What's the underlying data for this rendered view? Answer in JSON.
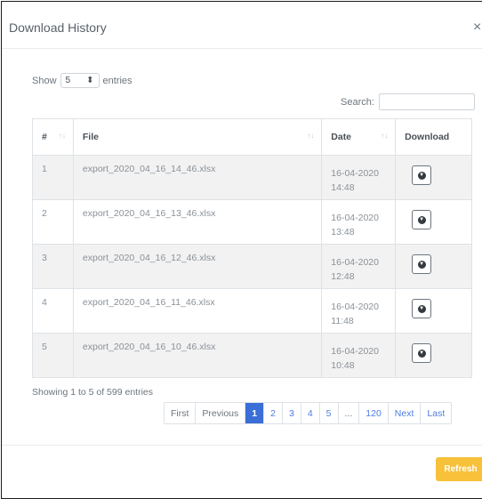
{
  "modal": {
    "title": "Download History",
    "close_glyph": "×"
  },
  "length": {
    "show_label": "Show",
    "value": "5",
    "entries_label": "entries"
  },
  "search": {
    "label": "Search:",
    "value": ""
  },
  "table": {
    "headers": [
      "#",
      "File",
      "Date",
      "Download"
    ],
    "rows": [
      {
        "index": "1",
        "file": "export_2020_04_16_14_46.xlsx",
        "date": "16-04-2020",
        "time": "14:48"
      },
      {
        "index": "2",
        "file": "export_2020_04_16_13_46.xlsx",
        "date": "16-04-2020",
        "time": "13:48"
      },
      {
        "index": "3",
        "file": "export_2020_04_16_12_46.xlsx",
        "date": "16-04-2020",
        "time": "12:48"
      },
      {
        "index": "4",
        "file": "export_2020_04_16_11_46.xlsx",
        "date": "16-04-2020",
        "time": "11:48"
      },
      {
        "index": "5",
        "file": "export_2020_04_16_10_46.xlsx",
        "date": "16-04-2020",
        "time": "10:48"
      }
    ]
  },
  "info": "Showing 1 to 5 of 599 entries",
  "pagination": {
    "first": "First",
    "previous": "Previous",
    "pages": [
      "1",
      "2",
      "3",
      "4",
      "5",
      "...",
      "120"
    ],
    "active": "1",
    "next": "Next",
    "last": "Last"
  },
  "footer": {
    "refresh_label": "Refresh"
  },
  "colors": {
    "accent": "#3b6ed6",
    "refresh": "#f7c139"
  },
  "icons": {
    "download": "download-icon",
    "close": "close-icon",
    "sort": "sort-icon"
  }
}
